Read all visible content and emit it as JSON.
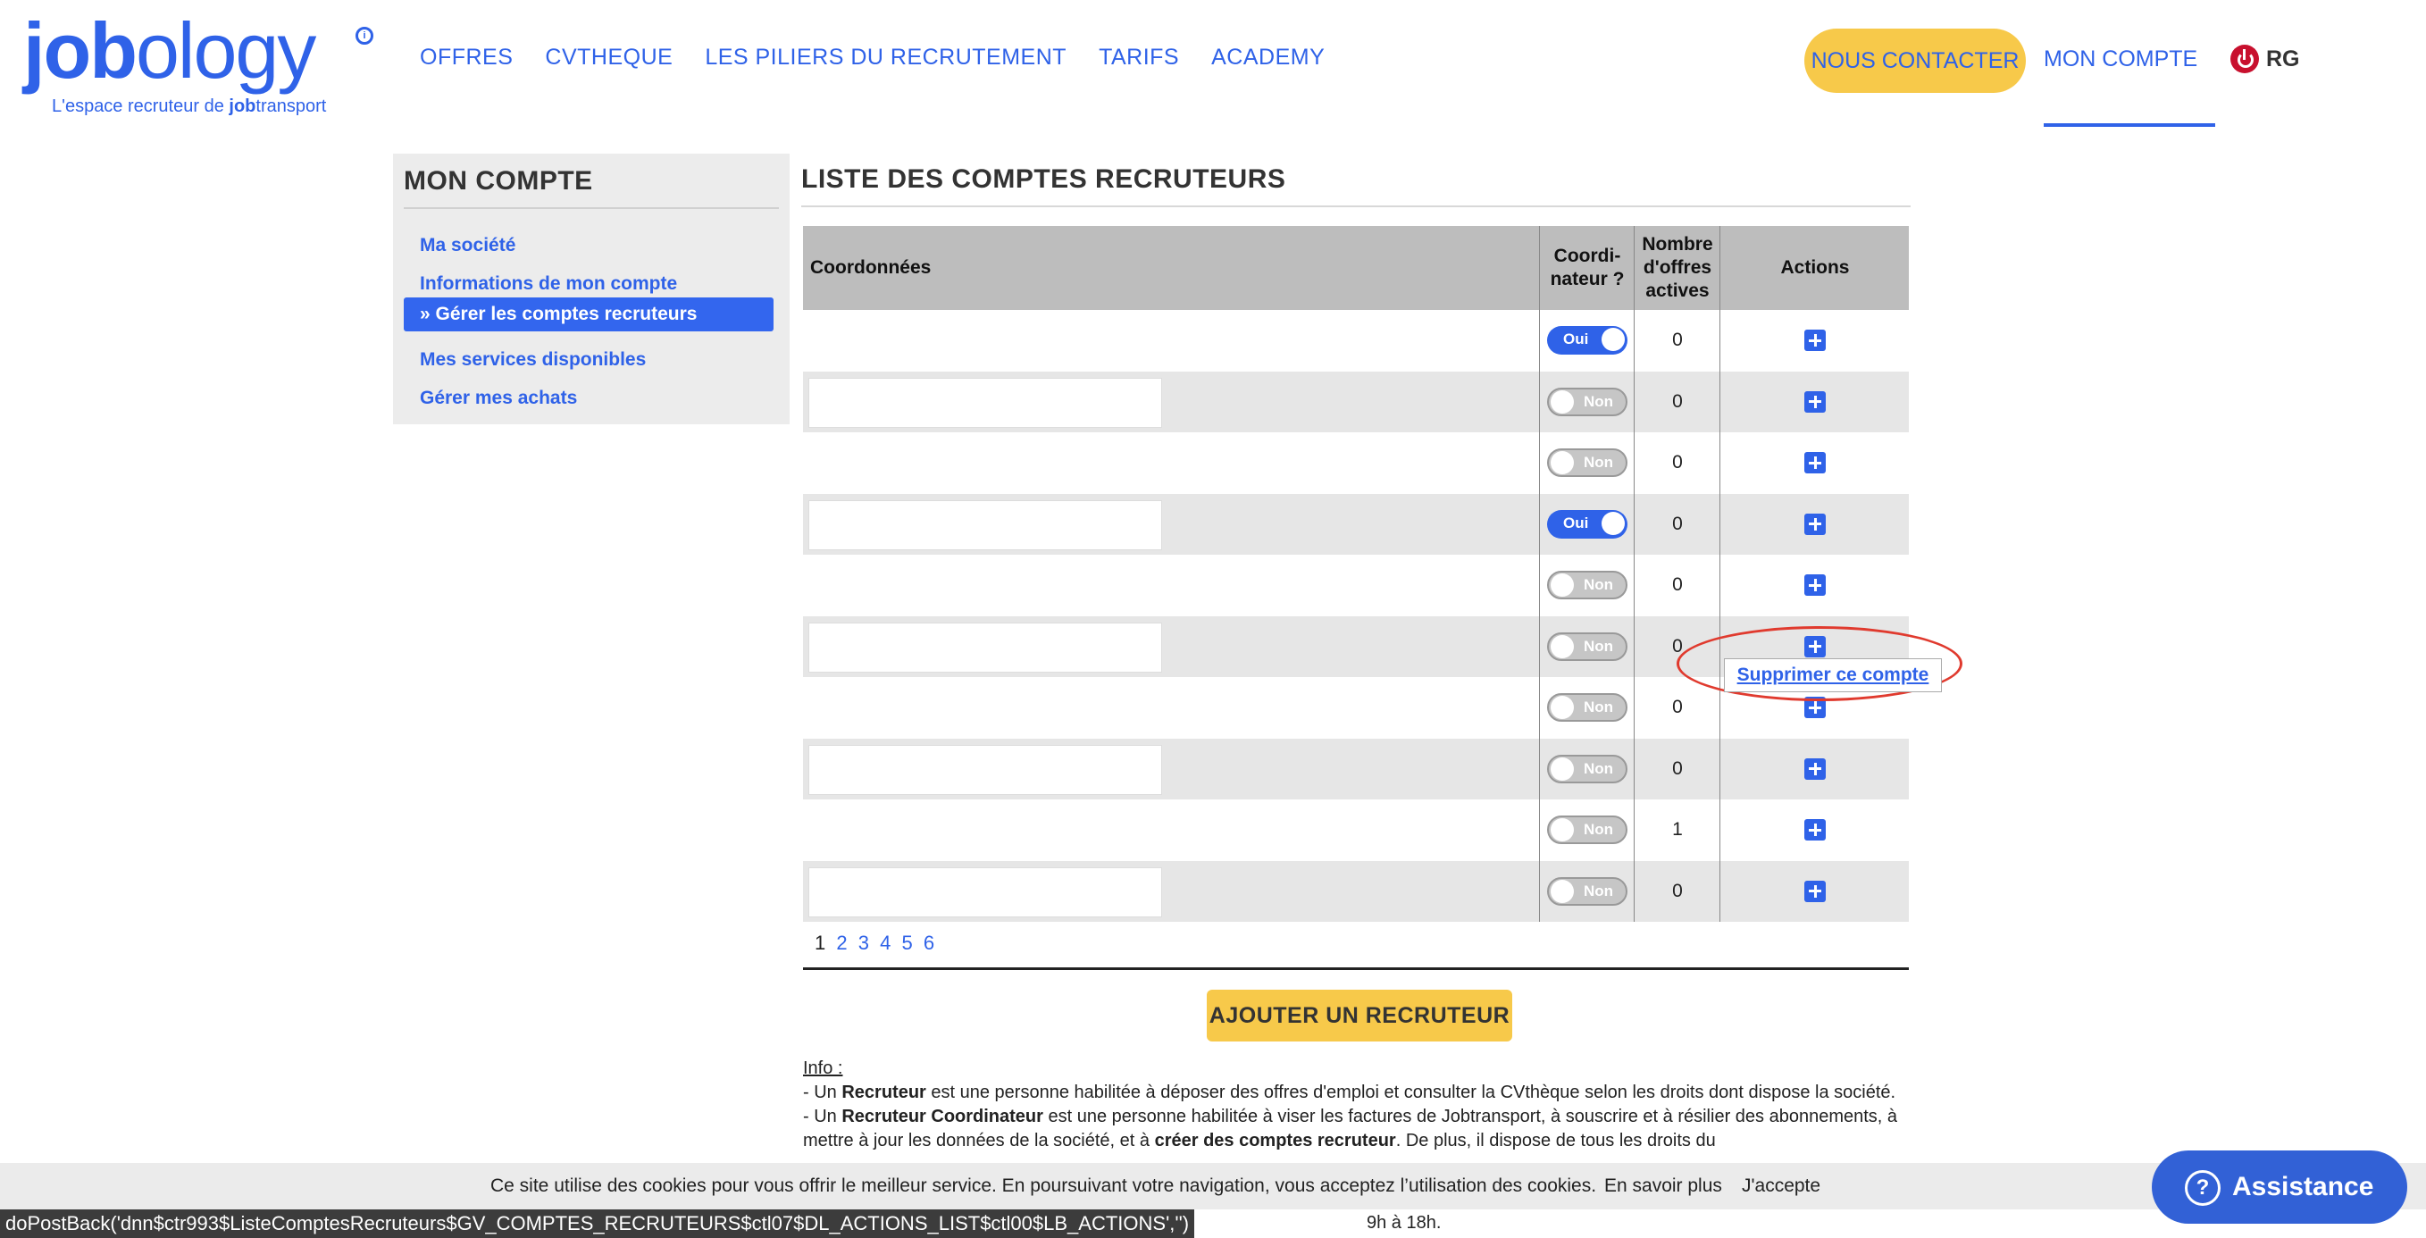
{
  "header": {
    "logo_word_bold": "job",
    "logo_word_light": "ology",
    "logo_tagline_prefix": "L'espace recruteur de ",
    "logo_tagline_brand_bold": "job",
    "logo_tagline_brand_rest": "transport",
    "nav": [
      "OFFRES",
      "CVTHEQUE",
      "LES PILIERS DU RECRUTEMENT",
      "TARIFS",
      "ACADEMY"
    ],
    "contact_label": "NOUS CONTACTER",
    "account_label": "MON COMPTE",
    "user_initials": "RG"
  },
  "sidebar": {
    "title": "MON COMPTE",
    "items": [
      {
        "label": "Ma société"
      },
      {
        "label": "Informations de mon compte"
      },
      {
        "label": "» Gérer les comptes recruteurs"
      },
      {
        "label": "Mes services disponibles"
      },
      {
        "label": "Gérer mes achats"
      }
    ]
  },
  "main": {
    "title": "LISTE DES COMPTES RECRUTEURS",
    "columns": {
      "coords": "Coordonnées",
      "coordinator_l1": "Coordi-",
      "coordinator_l2": "nateur ?",
      "offers_l1": "Nombre",
      "offers_l2": "d'offres",
      "offers_l3": "actives",
      "actions": "Actions"
    },
    "rows": [
      {
        "coordinator": "Oui",
        "offers": "0"
      },
      {
        "coordinator": "Non",
        "offers": "0"
      },
      {
        "coordinator": "Non",
        "offers": "0"
      },
      {
        "coordinator": "Oui",
        "offers": "0"
      },
      {
        "coordinator": "Non",
        "offers": "0"
      },
      {
        "coordinator": "Non",
        "offers": "0"
      },
      {
        "coordinator": "Non",
        "offers": "0"
      },
      {
        "coordinator": "Non",
        "offers": "0"
      },
      {
        "coordinator": "Non",
        "offers": "1"
      },
      {
        "coordinator": "Non",
        "offers": "0"
      }
    ],
    "tooltip_delete": "Supprimer ce compte",
    "pagination": {
      "current": "1",
      "pages": [
        "2",
        "3",
        "4",
        "5",
        "6"
      ]
    },
    "add_button": "AJOUTER UN RECRUTEUR",
    "info": {
      "heading": "Info :",
      "l1_pre": "- Un ",
      "l1_bold": "Recruteur",
      "l1_post": " est une personne habilitée à déposer des offres d'emploi et consulter la CVthèque selon les droits dont dispose la société.",
      "l2_pre": "- Un ",
      "l2_bold": "Recruteur Coordinateur",
      "l2_post": " est une personne habilitée à viser les factures de Jobtransport, à souscrire et à résilier des abonnements, à mettre à jour les données de la société, et à ",
      "l2_bold2": "créer des comptes recruteur",
      "l2_post2": ". De plus, il dispose de tous les droits du"
    }
  },
  "cookie": {
    "message": "Ce site utilise des cookies pour vous offrir le meilleur service. En poursuivant votre navigation, vous acceptez l’utilisation des cookies.",
    "more": "En savoir plus",
    "accept": "J'accepte"
  },
  "status": {
    "url": "doPostBack('dnn$ctr993$ListeComptesRecruteurs$GV_COMPTES_RECRUTEURS$ctl07$DL_ACTIONS_LIST$ctl00$LB_ACTIONS','')",
    "tail": "9h à 18h."
  },
  "assistance": {
    "label": "Assistance"
  },
  "colors": {
    "brand_blue": "#2f62e8",
    "accent_yellow": "#f7c94a",
    "annotation_red": "#e03a2e"
  }
}
